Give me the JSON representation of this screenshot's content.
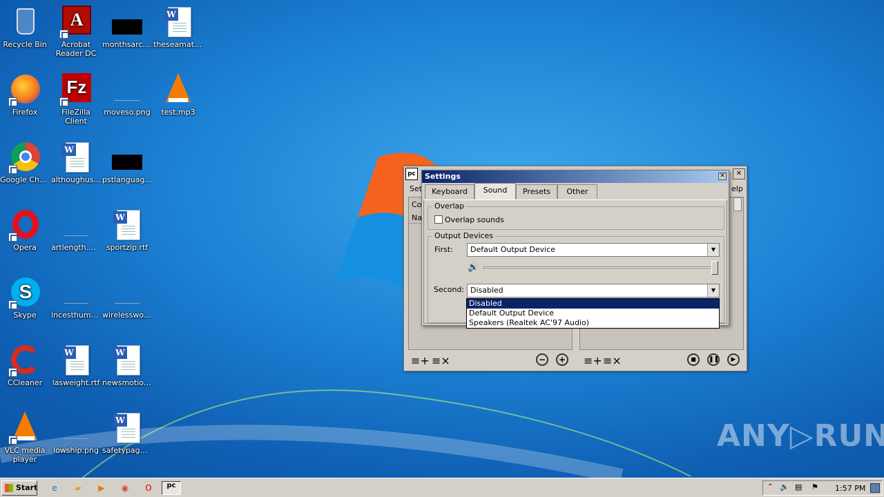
{
  "desktop": {
    "icons": [
      {
        "label": "Recycle Bin",
        "icon": "recycle-bin-icon"
      },
      {
        "label": "Acrobat Reader DC",
        "icon": "acrobat-icon"
      },
      {
        "label": "monthsarchi...",
        "icon": "image-file-icon"
      },
      {
        "label": "theseamate...",
        "icon": "word-doc-icon"
      },
      {
        "label": "Firefox",
        "icon": "firefox-icon"
      },
      {
        "label": "FileZilla Client",
        "icon": "filezilla-icon"
      },
      {
        "label": "moveso.png",
        "icon": "image-file-icon"
      },
      {
        "label": "test.mp3",
        "icon": "vlc-file-icon"
      },
      {
        "label": "Google Chrome",
        "icon": "chrome-icon"
      },
      {
        "label": "althoughus...",
        "icon": "word-doc-icon"
      },
      {
        "label": "pstlanguag...",
        "icon": "image-file-icon"
      },
      {
        "label": "Opera",
        "icon": "opera-icon"
      },
      {
        "label": "artlength.png",
        "icon": "image-file-icon"
      },
      {
        "label": "sportzip.rtf",
        "icon": "word-doc-icon"
      },
      {
        "label": "Skype",
        "icon": "skype-icon"
      },
      {
        "label": "incesthuma...",
        "icon": "image-file-icon"
      },
      {
        "label": "wirelesswor...",
        "icon": "image-file-icon"
      },
      {
        "label": "CCleaner",
        "icon": "ccleaner-icon"
      },
      {
        "label": "lasweight.rtf",
        "icon": "word-doc-icon"
      },
      {
        "label": "newsmotion...",
        "icon": "word-doc-icon"
      },
      {
        "label": "VLC media player",
        "icon": "vlc-icon"
      },
      {
        "label": "lowship.png",
        "icon": "image-file-icon"
      },
      {
        "label": "safetypage.rtf",
        "icon": "word-doc-icon"
      }
    ]
  },
  "bg_window": {
    "side_labels": [
      "Set",
      "Co",
      "Na"
    ],
    "side_label_right": "elp",
    "close": "✕"
  },
  "settings": {
    "title": "Settings",
    "tabs": [
      "Keyboard",
      "Sound",
      "Presets",
      "Other"
    ],
    "active_tab": "Sound",
    "overlap": {
      "group_label": "Overlap",
      "checkbox_label": "Overlap sounds",
      "checked": false
    },
    "output": {
      "group_label": "Output Devices",
      "first_label": "First:",
      "first_value": "Default Output Device",
      "volume_level": 1.0,
      "second_label": "Second:",
      "second_value": "Disabled",
      "dropdown_options": [
        "Disabled",
        "Default Output Device",
        "Speakers (Realtek AC'97 Audio)"
      ],
      "selected_option": "Disabled"
    }
  },
  "taskbar": {
    "start_label": "Start",
    "clock": "1:57 PM",
    "pinned": [
      "internet-explorer-icon",
      "explorer-folder-icon",
      "media-player-icon",
      "chrome-icon",
      "opera-icon",
      "soundpad-icon"
    ]
  },
  "watermark": "ANY▷RUN"
}
